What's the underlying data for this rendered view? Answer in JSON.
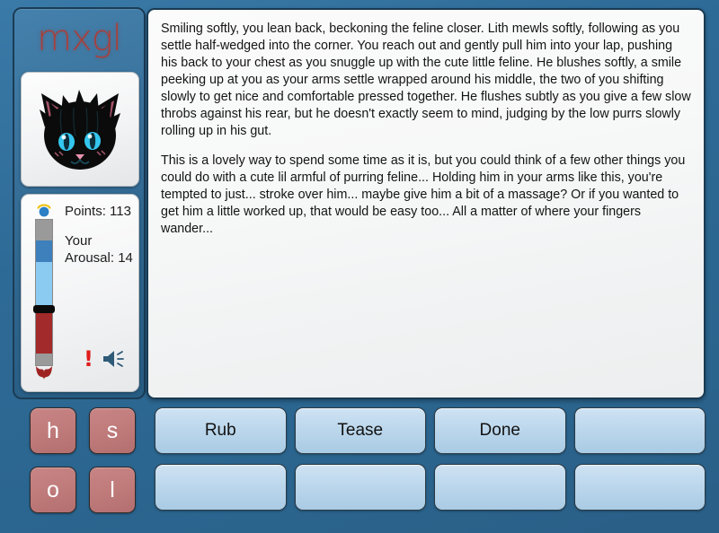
{
  "app": {
    "logo_text": "mxgl",
    "accent_red": "#a7403c",
    "background_blue": "#2e6a96"
  },
  "sidebar": {
    "avatar": {
      "icon": "black-cat-head-avatar",
      "body_color": "#0b0b0b",
      "eye_color": "#34c6ef",
      "inner_ear_color": "#a8556b",
      "nose_color": "#e894ae"
    },
    "stats": {
      "points_label": "Points: 113",
      "arousal_label": "Your\nArousal: 14",
      "arousal_label_line1": "Your",
      "arousal_label_line2": "Arousal: 14",
      "points_value": 113,
      "arousal_value": 14
    },
    "meter": {
      "top_icon": "halo-angel-icon",
      "bottom_icon": "devil-horns-icon",
      "halo_color": "#f0c419",
      "head_color": "#2b7fc4",
      "track_color": "#9a9a9a",
      "segment_dark_blue": "#3d80bb",
      "segment_light_blue": "#8bcbf2",
      "divider_color": "#0a0a0a",
      "segment_red": "#a32a2a",
      "horns_color": "#9e2222"
    },
    "alerts": {
      "warning_icon": "exclamation-icon",
      "warning_color": "#e01b1b",
      "sound_icon": "speaker-volume-icon",
      "sound_color": "#2e5a78"
    }
  },
  "main": {
    "story_paragraphs": [
      "Smiling softly, you lean back, beckoning the feline closer. Lith mewls softly, following as you settle half-wedged into the corner. You reach out and gently pull him into your lap, pushing his back to your chest as you snuggle up with the cute little feline. He blushes softly, a smile peeking up at you as your arms settle wrapped around his middle, the two of you shifting slowly to get nice and comfortable pressed together. He flushes subtly as you give a few slow throbs against his rear, but he doesn't exactly seem to mind, judging by the low purrs slowly rolling up in his gut.",
      "This is a lovely way to spend some time as it is, but you could think of a few other things you could do with a cute lil armful of purring feline... Holding him in your arms like this, you're tempted to just... stroke over him... maybe give him a bit of a massage? Or if you wanted to get him a little worked up, that would be easy too... All a matter of where your fingers wander..."
    ]
  },
  "controls": {
    "letter_keys": [
      "h",
      "s",
      "o",
      "l"
    ],
    "action_buttons": [
      "Rub",
      "Tease",
      "Done",
      "",
      "",
      "",
      "",
      ""
    ]
  }
}
